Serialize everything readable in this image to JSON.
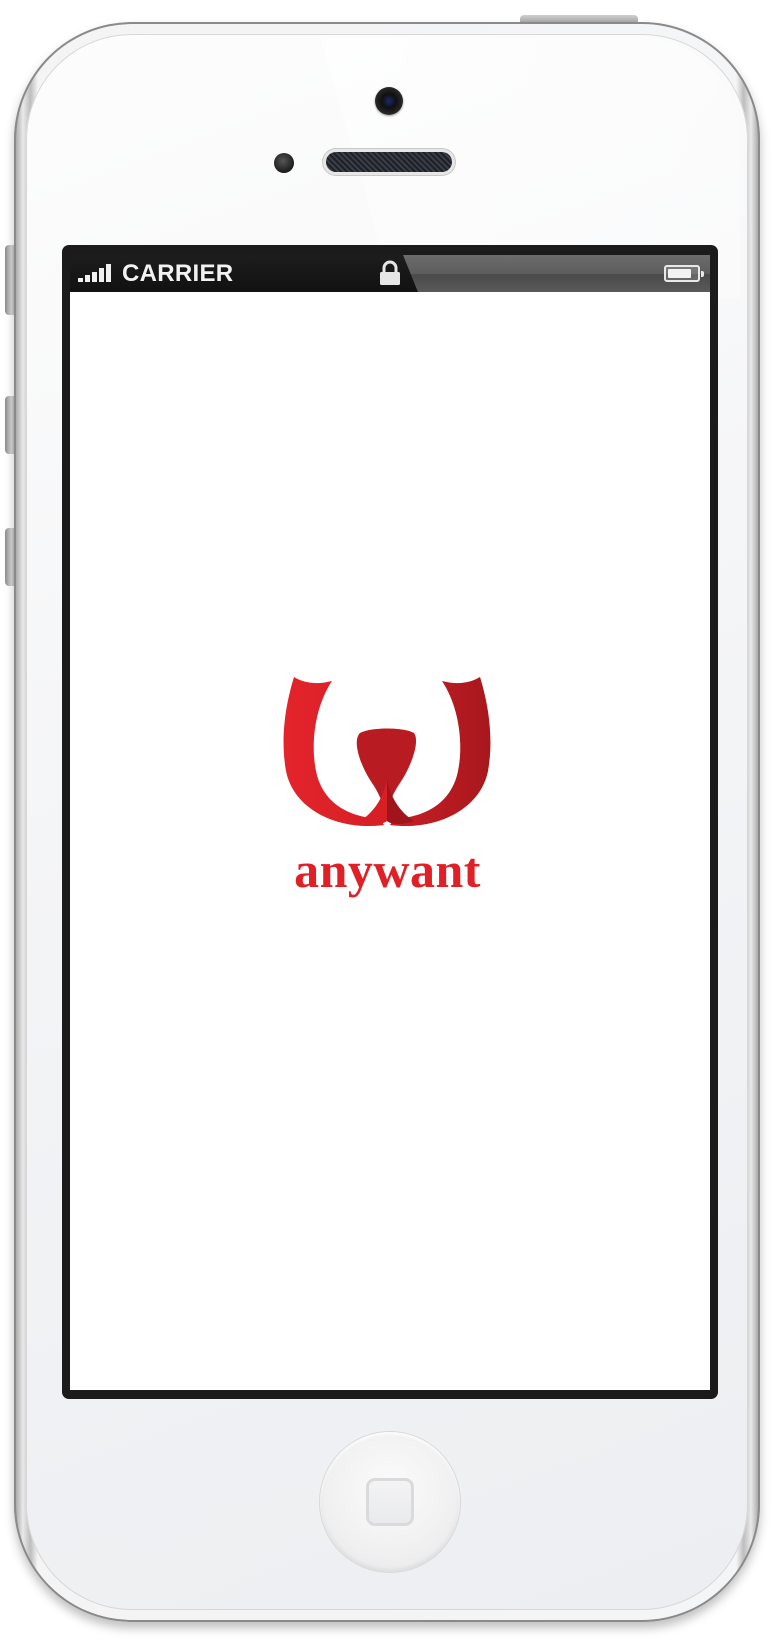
{
  "status_bar": {
    "carrier": "CARRIER",
    "signal_bars": 5,
    "signal_icon": "signal-bars-icon",
    "lock_icon": "lock-icon",
    "battery_icon": "battery-icon",
    "battery_level": 0.85
  },
  "splash": {
    "logo_icon": "anywant-logo-mark",
    "wordmark": "anywant"
  },
  "device": {
    "home_button_icon": "home-button"
  },
  "colors": {
    "brand_red": "#e02027",
    "brand_dark_red": "#b81c22",
    "status_bar": "#111111",
    "screen_background": "#ffffff"
  }
}
